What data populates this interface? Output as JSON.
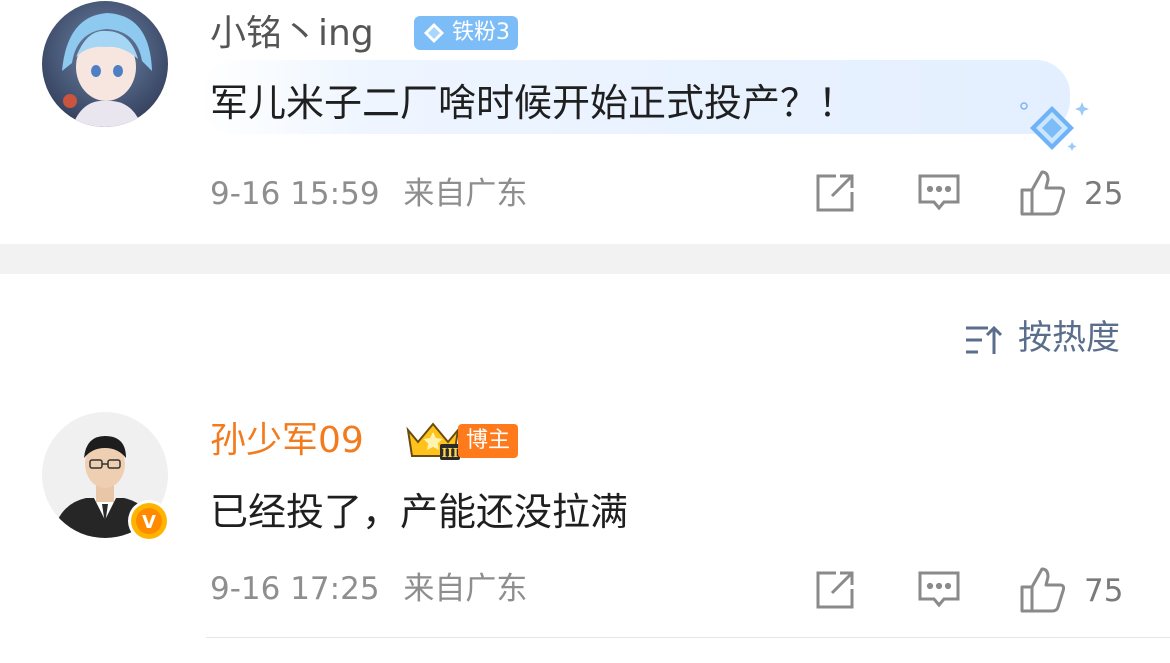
{
  "comments": [
    {
      "username": "小铭丶ing",
      "fan_badge": "铁粉3",
      "text": "军儿米子二厂啥时候开始正式投产？！",
      "time": "9-16 15:59",
      "location": "来自广东",
      "likes": "25",
      "username_color": "#555555"
    },
    {
      "username": "孙少军09",
      "host_badge": "博主",
      "text": "已经投了，产能还没拉满",
      "time": "9-16 17:25",
      "location": "来自广东",
      "likes": "75",
      "username_color": "#f27b1e",
      "verified_badge": "V"
    }
  ],
  "sort": {
    "label": "按热度"
  },
  "icons": {
    "share": "share-icon",
    "comment": "comment-icon",
    "like": "thumbs-up-icon",
    "sort": "sort-icon",
    "diamond": "diamond-icon",
    "crown": "crown-icon"
  },
  "colors": {
    "accent_blue": "#5a6e8c",
    "host_orange": "#ff7a1a",
    "fan_blue": "#7dbdf7"
  }
}
